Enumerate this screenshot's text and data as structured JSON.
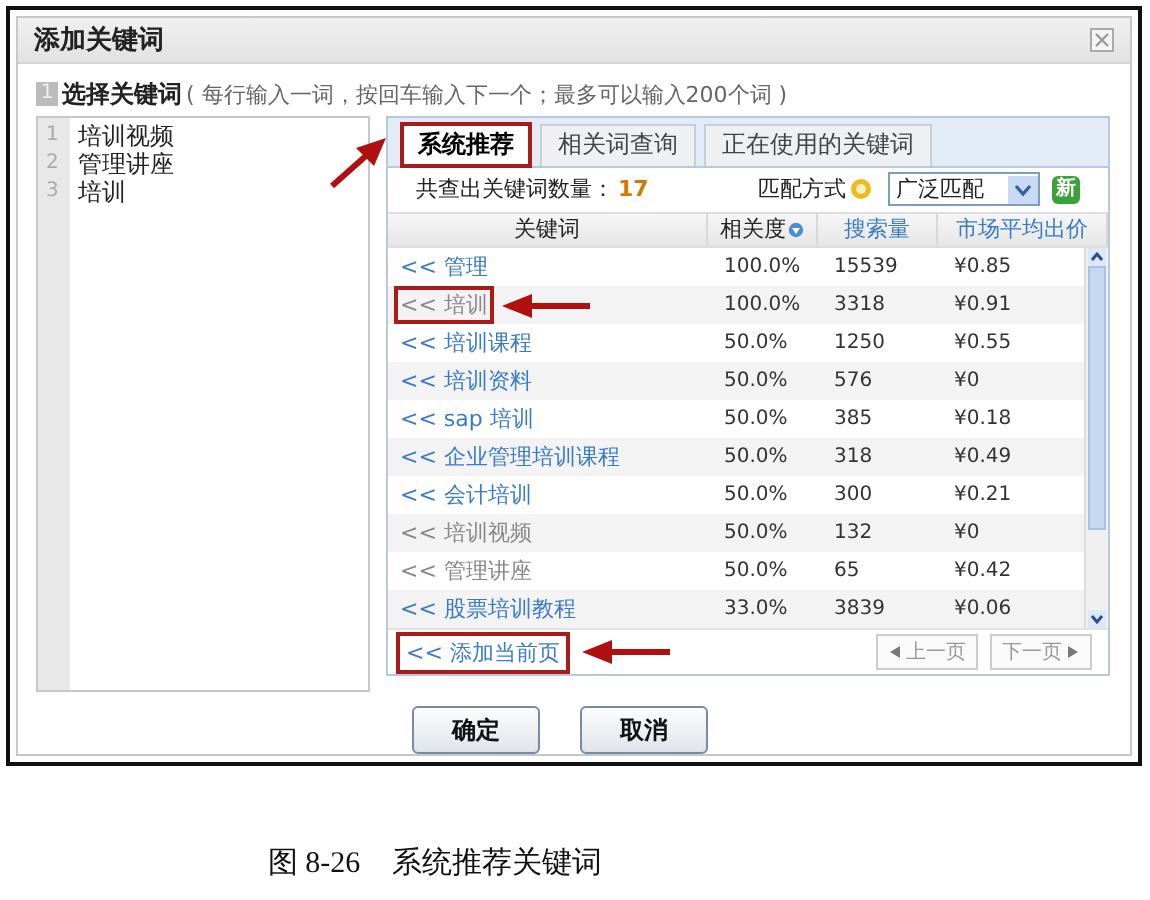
{
  "dialog": {
    "title": "添加关键词"
  },
  "instruction": {
    "step": "1",
    "label": "选择关键词",
    "hint": "( 每行输入一词，按回车输入下一个；最多可以输入200个词 )"
  },
  "keyword_input": {
    "lines": [
      {
        "number": "1",
        "text": "培训视频"
      },
      {
        "number": "2",
        "text": "管理讲座"
      },
      {
        "number": "3",
        "text": "培训"
      }
    ]
  },
  "tabs": [
    {
      "label": "系统推荐",
      "selected": true,
      "highlighted": true
    },
    {
      "label": "相关词查询",
      "selected": false,
      "highlighted": false
    },
    {
      "label": "正在使用的关键词",
      "selected": false,
      "highlighted": false
    }
  ],
  "summary": {
    "label": "共查出关键词数量：",
    "count": "17"
  },
  "match": {
    "label": "匹配方式",
    "value": "广泛匹配",
    "badge": "新"
  },
  "table": {
    "columns": [
      {
        "label": "关键词",
        "kind": "plain"
      },
      {
        "label": "相关度",
        "kind": "sorted"
      },
      {
        "label": "搜索量",
        "kind": "link"
      },
      {
        "label": "市场平均出价",
        "kind": "link"
      }
    ],
    "rows": [
      {
        "keyword": "<< 管理",
        "relevance": "100.0%",
        "searches": "15539",
        "price": "¥0.85",
        "added": false,
        "highlighted": false
      },
      {
        "keyword": "<< 培训",
        "relevance": "100.0%",
        "searches": "3318",
        "price": "¥0.91",
        "added": true,
        "highlighted": true
      },
      {
        "keyword": "<< 培训课程",
        "relevance": "50.0%",
        "searches": "1250",
        "price": "¥0.55",
        "added": false,
        "highlighted": false
      },
      {
        "keyword": "<< 培训资料",
        "relevance": "50.0%",
        "searches": "576",
        "price": "¥0",
        "added": false,
        "highlighted": false
      },
      {
        "keyword": "<< sap 培训",
        "relevance": "50.0%",
        "searches": "385",
        "price": "¥0.18",
        "added": false,
        "highlighted": false
      },
      {
        "keyword": "<< 企业管理培训课程",
        "relevance": "50.0%",
        "searches": "318",
        "price": "¥0.49",
        "added": false,
        "highlighted": false
      },
      {
        "keyword": "<< 会计培训",
        "relevance": "50.0%",
        "searches": "300",
        "price": "¥0.21",
        "added": false,
        "highlighted": false
      },
      {
        "keyword": "<< 培训视频",
        "relevance": "50.0%",
        "searches": "132",
        "price": "¥0",
        "added": true,
        "highlighted": false
      },
      {
        "keyword": "<< 管理讲座",
        "relevance": "50.0%",
        "searches": "65",
        "price": "¥0.42",
        "added": true,
        "highlighted": false
      },
      {
        "keyword": "<< 股票培训教程",
        "relevance": "33.0%",
        "searches": "3839",
        "price": "¥0.06",
        "added": false,
        "highlighted": false
      }
    ]
  },
  "add_page": {
    "label": "<< 添加当前页",
    "highlighted": true
  },
  "pager": [
    {
      "label": "上一页",
      "kind": "prev",
      "disabled": true
    },
    {
      "label": "下一页",
      "kind": "next",
      "disabled": true
    }
  ],
  "buttons": [
    {
      "label": "确定"
    },
    {
      "label": "取消"
    }
  ],
  "caption": {
    "number": "图 8-26",
    "text": "系统推荐关键词"
  }
}
